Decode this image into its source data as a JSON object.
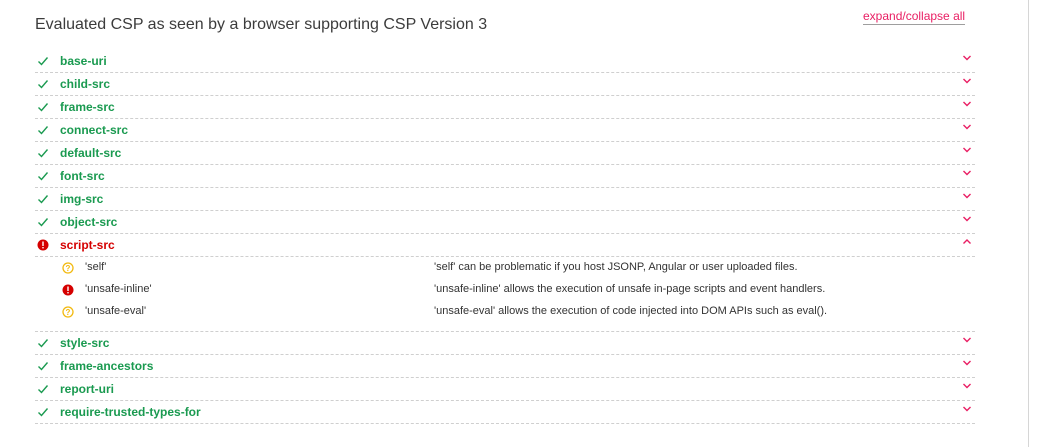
{
  "header": {
    "title": "Evaluated CSP as seen by a browser supporting CSP Version 3",
    "expand_label": "expand/collapse all"
  },
  "colors": {
    "ok": "#1a9a50",
    "error": "#d50000",
    "warning": "#f2b90f",
    "accent": "#e91e63"
  },
  "directives_before": [
    {
      "name": "base-uri",
      "status": "ok",
      "icon": "check-icon"
    },
    {
      "name": "child-src",
      "status": "ok",
      "icon": "check-icon"
    },
    {
      "name": "frame-src",
      "status": "ok",
      "icon": "check-icon"
    },
    {
      "name": "connect-src",
      "status": "ok",
      "icon": "check-icon"
    },
    {
      "name": "default-src",
      "status": "ok",
      "icon": "check-icon"
    },
    {
      "name": "font-src",
      "status": "ok",
      "icon": "check-icon"
    },
    {
      "name": "img-src",
      "status": "ok",
      "icon": "check-icon"
    },
    {
      "name": "object-src",
      "status": "ok",
      "icon": "check-icon"
    }
  ],
  "expanded": {
    "name": "script-src",
    "status": "error",
    "icon": "error-icon",
    "values": [
      {
        "value": "'self'",
        "status": "warning",
        "icon": "question-icon",
        "description": "'self' can be problematic if you host JSONP, Angular or user uploaded files."
      },
      {
        "value": "'unsafe-inline'",
        "status": "error",
        "icon": "error-icon",
        "description": "'unsafe-inline' allows the execution of unsafe in-page scripts and event handlers."
      },
      {
        "value": "'unsafe-eval'",
        "status": "warning",
        "icon": "question-icon",
        "description": "'unsafe-eval' allows the execution of code injected into DOM APIs such as eval()."
      }
    ]
  },
  "directives_after": [
    {
      "name": "style-src",
      "status": "ok",
      "icon": "check-icon"
    },
    {
      "name": "frame-ancestors",
      "status": "ok",
      "icon": "check-icon"
    },
    {
      "name": "report-uri",
      "status": "ok",
      "icon": "check-icon"
    },
    {
      "name": "require-trusted-types-for",
      "status": "ok",
      "icon": "check-icon"
    }
  ]
}
